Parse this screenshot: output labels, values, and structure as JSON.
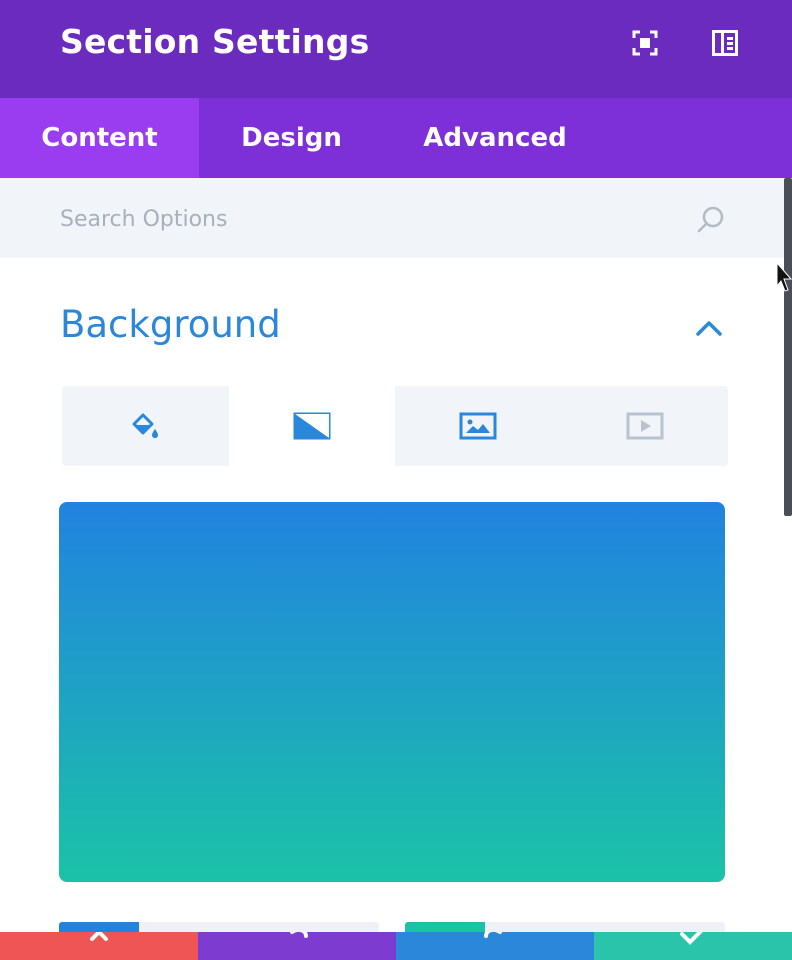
{
  "header": {
    "title": "Section Settings",
    "icons": [
      "fullscreen-icon",
      "sidebar-dock-icon"
    ]
  },
  "tabs": [
    {
      "label": "Content",
      "active": true
    },
    {
      "label": "Design",
      "active": false
    },
    {
      "label": "Advanced",
      "active": false
    }
  ],
  "search": {
    "placeholder": "Search Options",
    "value": ""
  },
  "section": {
    "title": "Background",
    "expanded": true
  },
  "background_tabs": [
    {
      "icon": "paint-bucket-icon",
      "active": false
    },
    {
      "icon": "gradient-icon",
      "active": true
    },
    {
      "icon": "image-icon",
      "active": false
    },
    {
      "icon": "video-icon",
      "active": false
    }
  ],
  "gradient": {
    "start_color": "#2282e0",
    "end_color": "#1bc3a6"
  },
  "colors": {
    "header_bg": "#6c2bbf",
    "tabs_bg": "#7d2fd8",
    "active_tab_bg": "#9a3cf0",
    "accent": "#2b87da",
    "footer_discard": "#ef5555",
    "footer_undo": "#7d3bcf",
    "footer_redo": "#2b87da",
    "footer_save": "#29c4a9"
  }
}
